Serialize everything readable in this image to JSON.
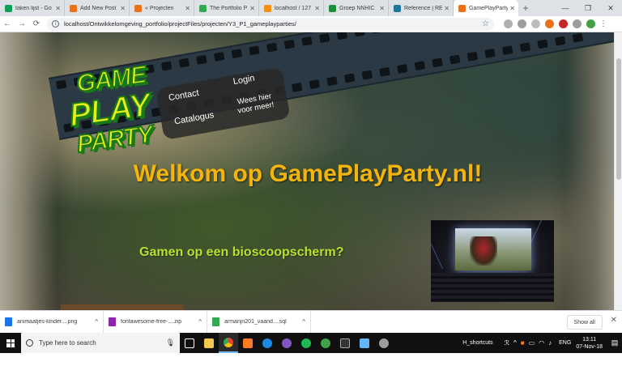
{
  "browser": {
    "tabs": [
      {
        "title": "taken lijst - Go",
        "color": "#0f9d58"
      },
      {
        "title": "Add New Post",
        "color": "#e8711a"
      },
      {
        "title": "« Projecten",
        "color": "#e8711a"
      },
      {
        "title": "The Portfolio P",
        "color": "#34a853"
      },
      {
        "title": "localhost / 127",
        "color": "#f29111"
      },
      {
        "title": "Groep NNHIC",
        "color": "#1e8e3e"
      },
      {
        "title": "Reference | RE",
        "color": "#21759b"
      },
      {
        "title": "GamePlayParty",
        "color": "#e8711a"
      }
    ],
    "url": "localhost/Ontwikkelomgeving_portfolio/projectFiles/projecten/Y3_P1_gameplayparties/"
  },
  "page": {
    "logo": {
      "line1": "GAME",
      "line2": "PLAY",
      "line3": "PARTY"
    },
    "nav": {
      "contact": "Contact",
      "login": "Login",
      "catalogus": "Catalogus",
      "wees": "Wees hier voor meer!"
    },
    "welcome": "Welkom op GamePlayParty.nl!",
    "subheading": "Gamen op een bioscoopscherm?"
  },
  "downloads": {
    "items": [
      {
        "name": "animaatjes-kinder....png",
        "color": "#1a73e8"
      },
      {
        "name": "fontawesome-free-....zip",
        "color": "#8e24aa"
      },
      {
        "name": "armanjn201_vaand....sql",
        "color": "#34a853"
      }
    ],
    "show_all": "Show all"
  },
  "taskbar": {
    "search_placeholder": "Type here to search",
    "shortcuts_label": "H_shortcuts",
    "language": "ENG",
    "time": "13:11",
    "date": "07-Nov-18"
  }
}
